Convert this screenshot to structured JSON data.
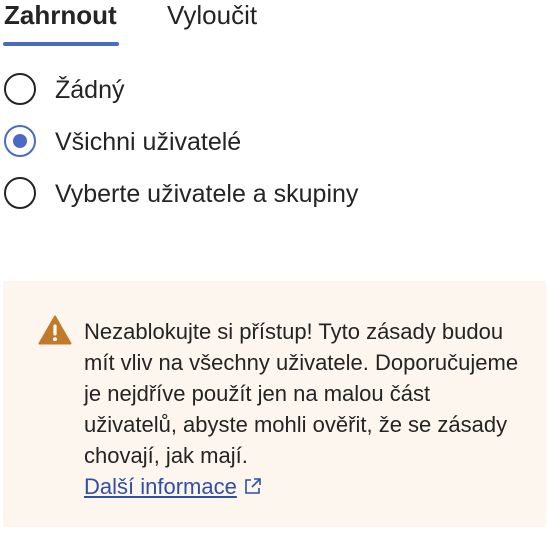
{
  "tabs": {
    "include_label": "Zahrnout",
    "exclude_label": "Vyloučit",
    "active": "include"
  },
  "radio_options": [
    {
      "label": "Žádný",
      "checked": false
    },
    {
      "label": "Všichni uživatelé",
      "checked": true
    },
    {
      "label": "Vyberte uživatele a skupiny",
      "checked": false
    }
  ],
  "warning": {
    "icon": "warning-triangle-icon",
    "text": "Nezablokujte si přístup! Tyto zásady budou mít vliv na všechny uživatele. Doporučujeme je nejdříve použít jen na malou část uživatelů, abyste mohli ověřit, že se zásady chovají, jak mají.",
    "link_label": "Další informace",
    "link_icon": "external-link-icon"
  },
  "colors": {
    "accent": "#4a6bc3",
    "link": "#2f4fa6",
    "warning_bg": "#fdf6ef",
    "warning_icon": "#c07a2a",
    "text": "#242424"
  }
}
